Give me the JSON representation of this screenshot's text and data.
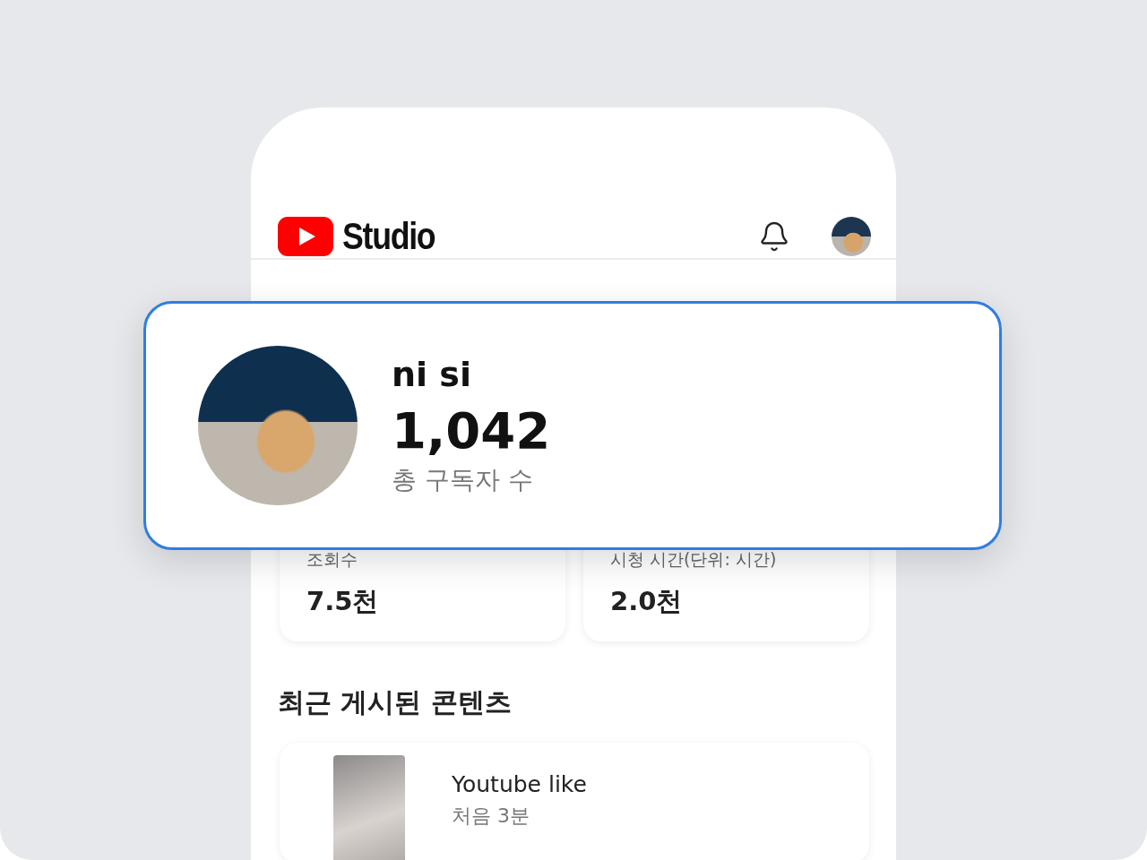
{
  "header": {
    "logo_text": "Studio"
  },
  "channel": {
    "name": "ni si",
    "subscribers": "1,042",
    "subscribers_label": "총 구독자 수"
  },
  "stats": [
    {
      "label": "조회수",
      "value": "7.5천"
    },
    {
      "label": "시청 시간(단위: 시간)",
      "value": "2.0천"
    }
  ],
  "recent": {
    "title": "최근 게시된 콘텐츠",
    "items": [
      {
        "title": "Youtube like",
        "meta": "처음 3분"
      }
    ]
  }
}
